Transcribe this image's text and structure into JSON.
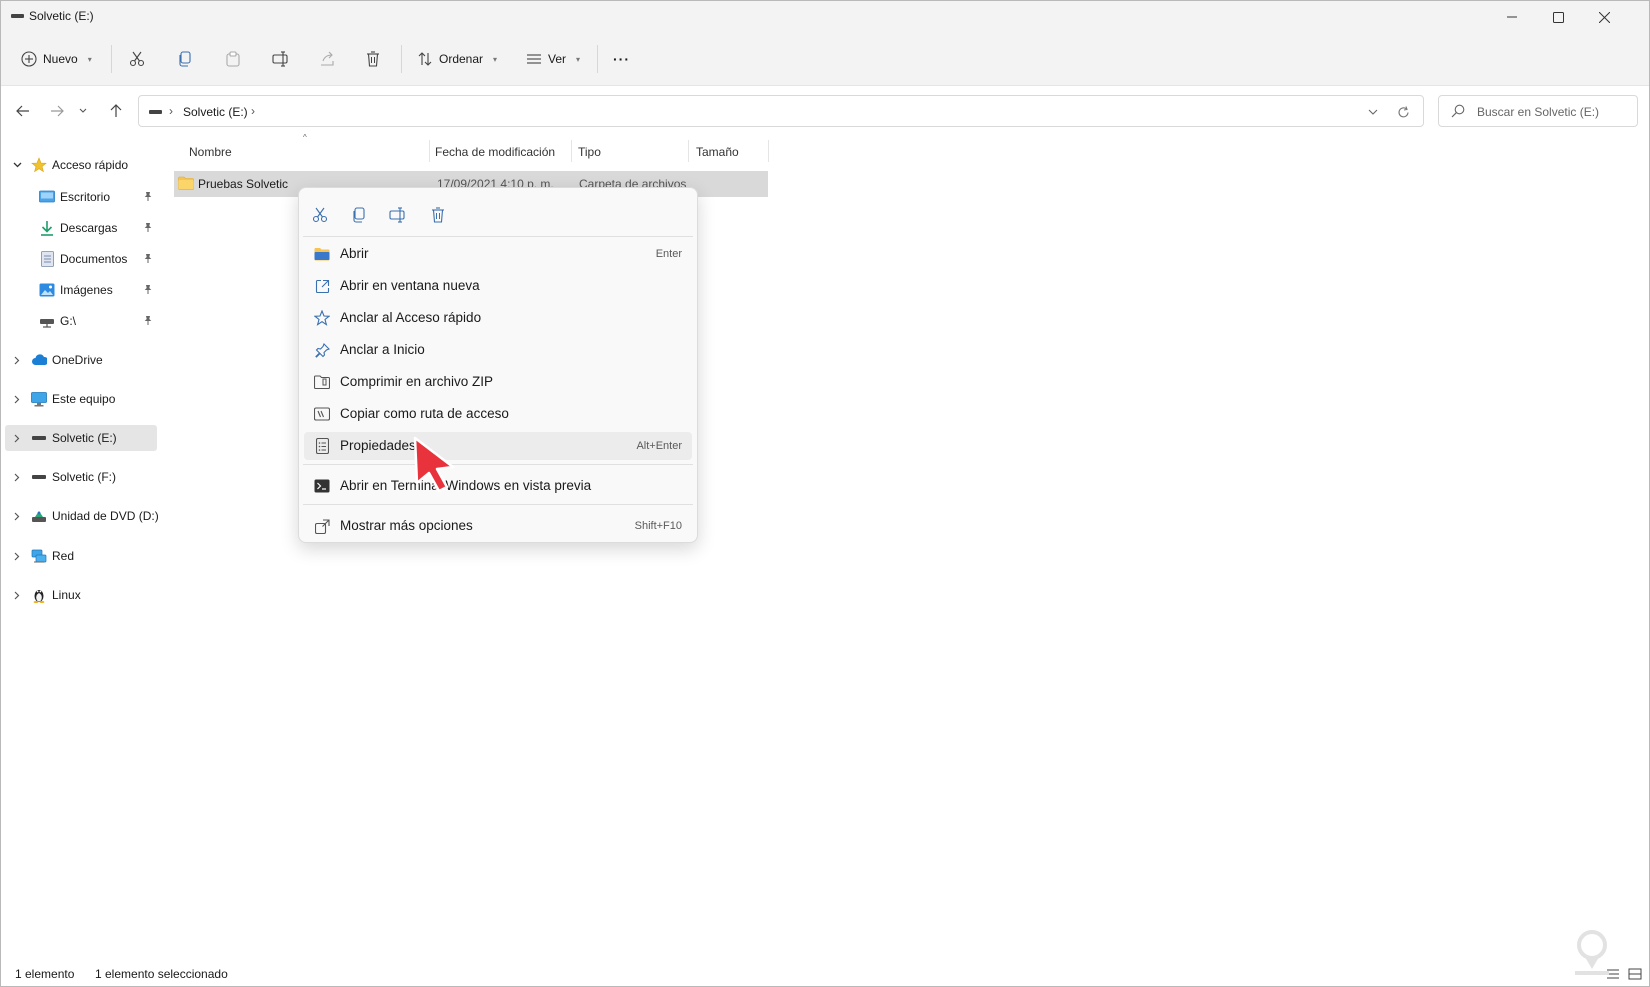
{
  "window": {
    "title": "Solvetic (E:)"
  },
  "toolbar": {
    "new_label": "Nuevo",
    "sort_label": "Ordenar",
    "view_label": "Ver",
    "more_label": "···"
  },
  "address": {
    "crumb": "Solvetic (E:)",
    "sep1": "›",
    "sep2": "›"
  },
  "search": {
    "placeholder": "Buscar en Solvetic (E:)"
  },
  "sidebar": {
    "items": [
      {
        "label": "Acceso rápido",
        "icon": "star-icon"
      },
      {
        "label": "Escritorio",
        "icon": "desktop-icon"
      },
      {
        "label": "Descargas",
        "icon": "download-icon"
      },
      {
        "label": "Documentos",
        "icon": "document-icon"
      },
      {
        "label": "Imágenes",
        "icon": "pictures-icon"
      },
      {
        "label": "G:\\",
        "icon": "network-drive-icon"
      },
      {
        "label": "OneDrive",
        "icon": "cloud-icon"
      },
      {
        "label": "Este equipo",
        "icon": "computer-icon"
      },
      {
        "label": "Solvetic (E:)",
        "icon": "drive-icon"
      },
      {
        "label": "Solvetic (F:)",
        "icon": "drive-icon"
      },
      {
        "label": "Unidad de DVD (D:)",
        "icon": "dvd-icon"
      },
      {
        "label": "Red",
        "icon": "network-icon"
      },
      {
        "label": "Linux",
        "icon": "linux-icon"
      }
    ]
  },
  "columns": {
    "name": "Nombre",
    "date": "Fecha de modificación",
    "type": "Tipo",
    "size": "Tamaño"
  },
  "file": {
    "name": "Pruebas Solvetic",
    "date": "17/09/2021 4:10 p. m.",
    "type": "Carpeta de archivos"
  },
  "context_menu": {
    "items": [
      {
        "label": "Abrir",
        "shortcut": "Enter"
      },
      {
        "label": "Abrir en ventana nueva",
        "shortcut": ""
      },
      {
        "label": "Anclar al Acceso rápido",
        "shortcut": ""
      },
      {
        "label": "Anclar a Inicio",
        "shortcut": ""
      },
      {
        "label": "Comprimir en archivo ZIP",
        "shortcut": ""
      },
      {
        "label": "Copiar como ruta de acceso",
        "shortcut": ""
      },
      {
        "label": "Propiedades",
        "shortcut": "Alt+Enter"
      },
      {
        "label": "Abrir en Terminal Windows en vista previa",
        "shortcut": ""
      },
      {
        "label": "Mostrar más opciones",
        "shortcut": "Shift+F10"
      }
    ]
  },
  "status": {
    "count": "1 elemento",
    "selected": "1 elemento seleccionado"
  },
  "colors": {
    "accent": "#0067c0",
    "folder": "#f8c44f",
    "cursor": "#e8333c"
  }
}
